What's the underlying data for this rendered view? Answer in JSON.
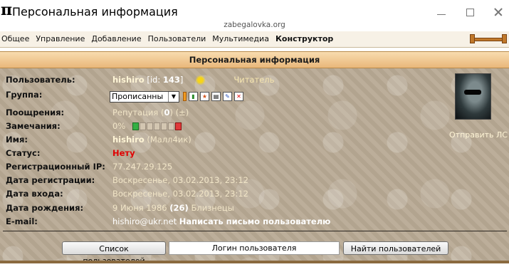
{
  "window": {
    "title": "Персональная информация",
    "url": "zabegalovka.org"
  },
  "menu": {
    "items": [
      "Общее",
      "Управление",
      "Добавление",
      "Пользователи",
      "Мультимедиа"
    ],
    "active": "Конструктор"
  },
  "panel_title": "Персональная информация",
  "profile": {
    "user_label": "Пользователь:",
    "username": "hishiro",
    "id_prefix": "[id:",
    "id_value": "143",
    "id_suffix": "]",
    "role": "Читатель",
    "group_label": "Группа:",
    "group_value": "Прописанны",
    "rewards_label": "Поощрения:",
    "reputation_text": "Репутация (",
    "reputation_value": "0",
    "reputation_suffix": ") (±)",
    "warnings_label": "Замечания:",
    "warnings_value": "0%",
    "name_label": "Имя:",
    "name_value": "hishiro",
    "name_alias": "(Малл4ик)",
    "status_label": "Статус:",
    "status_value": "Нету",
    "reg_ip_label": "Регистрационный IP:",
    "reg_ip_value": "77.247.29.125",
    "reg_date_label": "Дата регистрации:",
    "reg_date_value": "Воскресенье, 03.02.2013, 23:12",
    "login_date_label": "Дата входа:",
    "login_date_value": "Воскресенье, 03.02.2013, 23:12",
    "birth_label": "Дата рождения:",
    "birth_value": "9 Июня 1986",
    "birth_age": "(26)",
    "birth_sign": "Близнецы",
    "email_label": "E-mail:",
    "email_value": "hishiro@ukr.net",
    "email_action": "Написать письмо пользователю",
    "send_pm": "Отправить ЛС"
  },
  "bottom": {
    "list_button": "Список пользователей",
    "login_input": "Логин пользователя",
    "find_button": "Найти пользователей"
  },
  "icons": {
    "app": "pi-icon",
    "sun": "sun-icon"
  }
}
